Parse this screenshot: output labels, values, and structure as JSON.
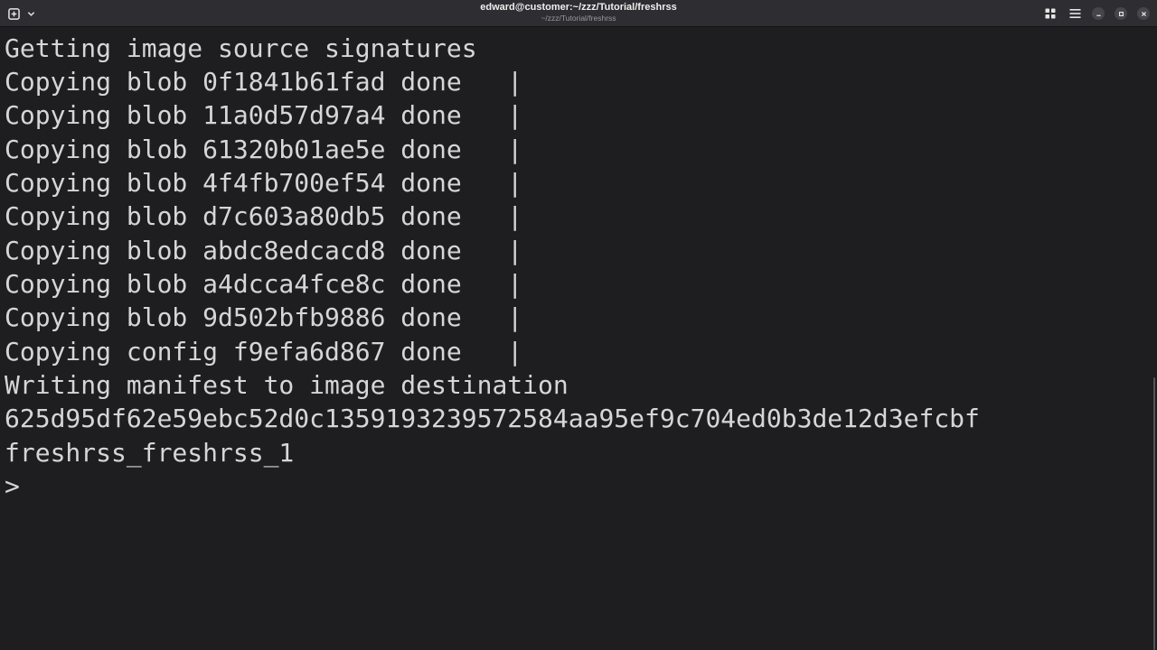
{
  "window": {
    "title": "edward@customer:~/zzz/Tutorial/freshrss",
    "subtitle": "~/zzz/Tutorial/freshrss"
  },
  "header": {
    "new_tab_icon": "new-tab-icon",
    "tab_menu_icon": "chevron-down-icon",
    "overview_icon": "grid-icon",
    "menu_icon": "hamburger-menu-icon",
    "minimize_icon": "minimize-icon",
    "maximize_icon": "maximize-icon",
    "close_icon": "close-icon"
  },
  "terminal": {
    "lines": [
      "Getting image source signatures",
      "Copying blob 0f1841b61fad done   |",
      "Copying blob 11a0d57d97a4 done   |",
      "Copying blob 61320b01ae5e done   |",
      "Copying blob 4f4fb700ef54 done   |",
      "Copying blob d7c603a80db5 done   |",
      "Copying blob abdc8edcacd8 done   |",
      "Copying blob a4dcca4fce8c done   |",
      "Copying blob 9d502bfb9886 done   |",
      "Copying config f9efa6d867 done   |",
      "Writing manifest to image destination",
      "625d95df62e59ebc52d0c1359193239572584aa95ef9c704ed0b3de12d3efcbf",
      "freshrss_freshrss_1"
    ],
    "prompt": ">"
  },
  "colors": {
    "background": "#1e1e21",
    "headerbar": "#2e2e32",
    "text": "#d6d6d6"
  }
}
